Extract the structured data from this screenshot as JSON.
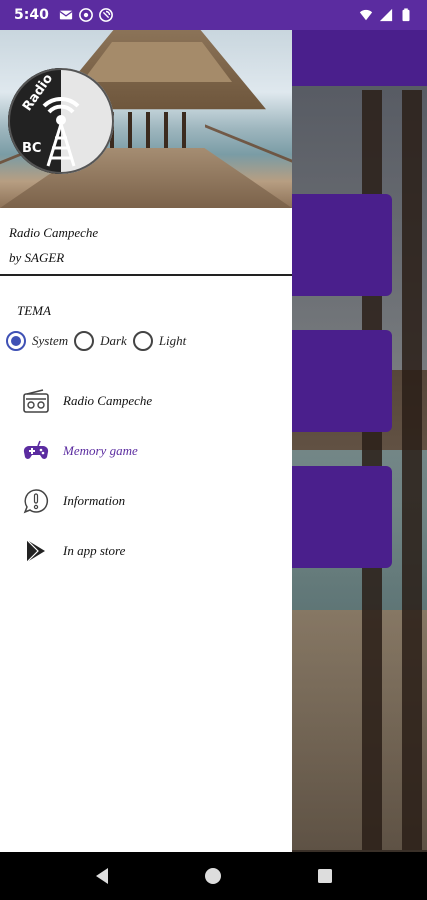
{
  "status_bar": {
    "time": "5:40",
    "background_color": "#5b2ca0",
    "left_icons": [
      "mail-icon",
      "alert-icon",
      "privacy-icon"
    ],
    "right_icons": [
      "wifi-icon",
      "signal-icon",
      "battery-icon"
    ]
  },
  "drawer": {
    "app_title": "Radio Campeche",
    "app_subtitle": "by SAGER",
    "logo_text_top": "Radio",
    "logo_text_bottom": "BC",
    "theme": {
      "label": "TEMA",
      "options": [
        {
          "label": "System",
          "checked": true
        },
        {
          "label": "Dark",
          "checked": false
        },
        {
          "label": "Light",
          "checked": false
        }
      ]
    },
    "menu": [
      {
        "label": "Radio Campeche",
        "icon": "radio-icon",
        "active": false
      },
      {
        "label": "Memory game",
        "icon": "gamepad-icon",
        "active": true
      },
      {
        "label": "Information",
        "icon": "info-bubble-icon",
        "active": false
      },
      {
        "label": "In app store",
        "icon": "play-store-icon",
        "active": false
      }
    ]
  },
  "colors": {
    "accent": "#5b2ca0",
    "radio_checked": "#3f51b5",
    "background_card": "#4a1f8c"
  },
  "nav_bar": {
    "icons": [
      "back-icon",
      "home-icon",
      "recents-icon"
    ]
  }
}
